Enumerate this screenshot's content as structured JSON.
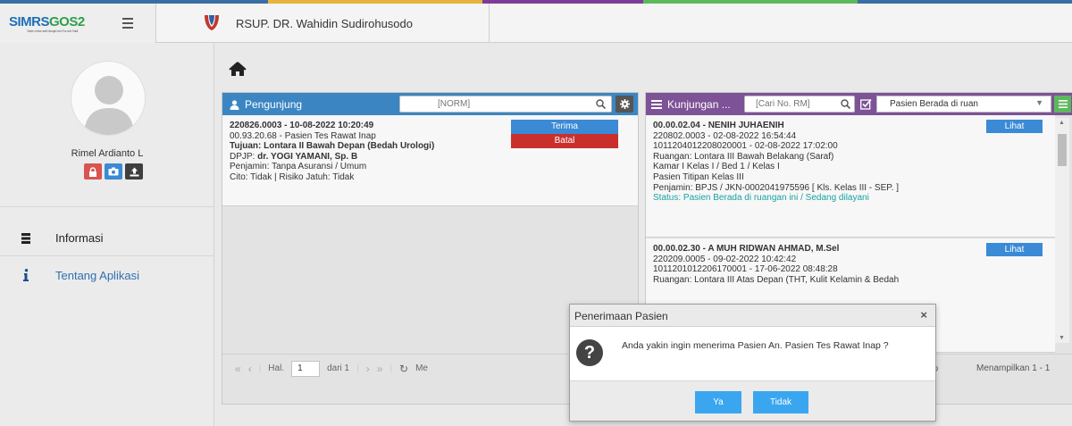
{
  "app": {
    "logo_text_a": "SIMRS",
    "logo_text_b": "GOS2",
    "logo_subtitle": "Sistem Informasi Manajemen Rumah Sakit",
    "hospital_name": "RSUP. DR. Wahidin Sudirohusodo"
  },
  "sidebar": {
    "user_name": "Rimel Ardianto L",
    "menu": [
      {
        "label": "Informasi",
        "icon": "database-icon"
      },
      {
        "label": "Tentang Aplikasi",
        "icon": "info-icon"
      }
    ]
  },
  "pengunjung": {
    "title": "Pengunjung",
    "search_placeholder": "[NORM]",
    "card": {
      "line1": "220826.0003 - 10-08-2022 10:20:49",
      "line2": "00.93.20.68 - Pasien Tes Rawat Inap",
      "line3": "Tujuan: Lontara II Bawah Depan (Bedah Urologi)",
      "line4_prefix": "DPJP: ",
      "line4_name": "dr. YOGI YAMANI, Sp. B",
      "line5": "Penjamin: Tanpa Asuransi / Umum",
      "line6": "Cito: Tidak | Risiko Jatuh: Tidak",
      "accept_label": "Terima",
      "cancel_label": "Batal"
    },
    "pager": {
      "page_label": "Hal.",
      "page_value": "1",
      "page_of": "dari 1",
      "info_fragment": "Me"
    }
  },
  "kunjungan": {
    "title": "Kunjungan ...",
    "search_placeholder": "[Cari No. RM]",
    "filter_value": "Pasien Berada di ruan",
    "visits": [
      {
        "header": "00.00.02.04 - NENIH JUHAENIH",
        "line2": "220802.0003 - 02-08-2022 16:54:44",
        "line3": "1011204012208020001 - 02-08-2022 17:02:00",
        "line4": "Ruangan: Lontara III Bawah Belakang (Saraf)",
        "line5": "Kamar I Kelas I / Bed 1 / Kelas I",
        "line6": "Pasien Titipan Kelas III",
        "line7": "Penjamin: BPJS / JKN-0002041975596 [ Kls. Kelas III - SEP. ]",
        "status": "Status: Pasien Berada di ruangan ini / Sedang dilayani",
        "action_label": "Lihat"
      },
      {
        "header": "00.00.02.30 - A MUH RIDWAN AHMAD, M.Sel",
        "line2": "220209.0005 - 09-02-2022 10:42:42",
        "line3": "1011201012206170001 - 17-06-2022 08:48:28",
        "line4": "Ruangan: Lontara III Atas Depan (THT, Kulit Kelamin & Bedah",
        "action_label": "Lihat"
      }
    ],
    "pager_info": "Menampilkan 1 - 1"
  },
  "modal": {
    "title": "Penerimaan Pasien",
    "message": "Anda yakin ingin menerima Pasien An. Pasien Tes Rawat Inap ?",
    "yes_label": "Ya",
    "no_label": "Tidak"
  }
}
